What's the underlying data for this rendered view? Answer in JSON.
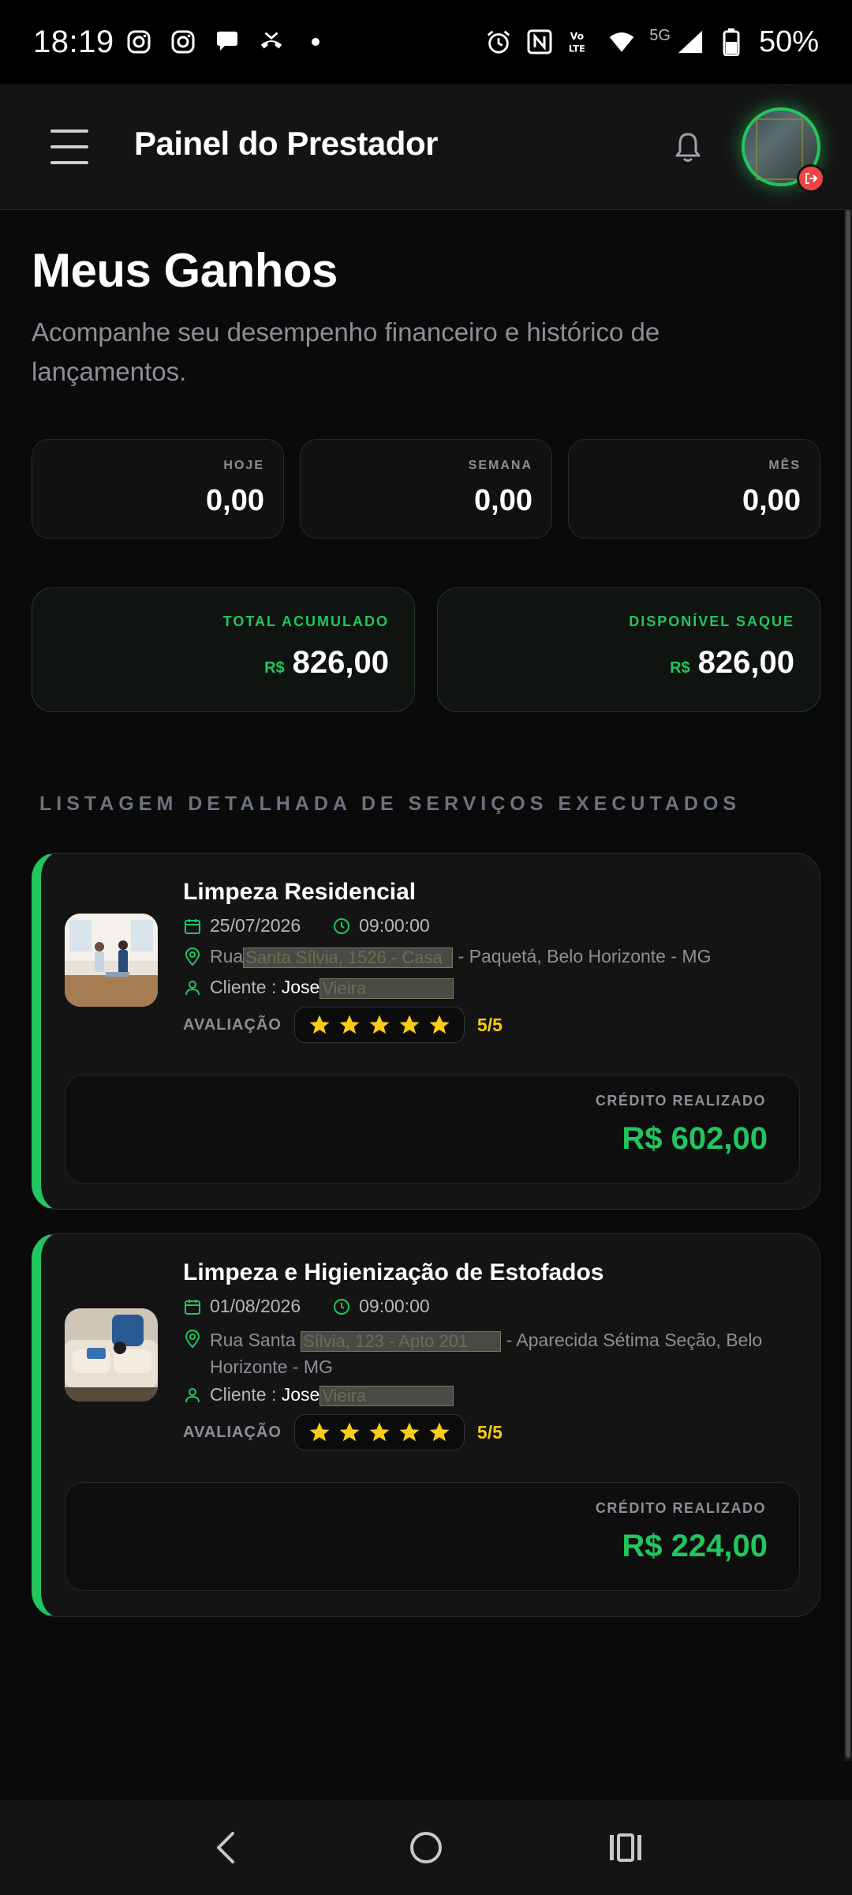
{
  "status_bar": {
    "time": "18:19",
    "network": "5G",
    "battery": "50%"
  },
  "header": {
    "title": "Painel do Prestador"
  },
  "page": {
    "title": "Meus Ganhos",
    "subtitle": "Acompanhe seu desempenho financeiro e histórico de lançamentos."
  },
  "stats": {
    "hoje": {
      "label": "HOJE",
      "value": "0,00"
    },
    "semana": {
      "label": "SEMANA",
      "value": "0,00"
    },
    "mes": {
      "label": "MÊS",
      "value": "0,00"
    },
    "total": {
      "label": "TOTAL ACUMULADO",
      "currency": "R$",
      "value": "826,00"
    },
    "disponivel": {
      "label": "DISPONÍVEL SAQUE",
      "currency": "R$",
      "value": "826,00"
    }
  },
  "section_heading": "LISTAGEM DETALHADA DE SERVIÇOS EXECUTADOS",
  "services": [
    {
      "title": "Limpeza Residencial",
      "date": "25/07/2026",
      "time": "09:00:00",
      "address_prefix": "Rua",
      "address_redacted": "Santa Sílvia, 1526 - Casa",
      "address_suffix": "- Paquetá, Belo Horizonte - MG",
      "client_label": "Cliente :",
      "client_name": "Jose",
      "client_redacted": "Vieira",
      "rating_label": "AVALIAÇÃO",
      "rating_score": "5/5",
      "rating_stars": 5,
      "credit_label": "CRÉDITO REALIZADO",
      "credit_value": "R$ 602,00"
    },
    {
      "title": "Limpeza e Higienização de Estofados",
      "date": "01/08/2026",
      "time": "09:00:00",
      "address_prefix": "Rua Santa",
      "address_redacted": "Sílvia, 123 - Apto 201",
      "address_suffix": "- Aparecida Sétima Seção, Belo Horizonte - MG",
      "client_label": "Cliente :",
      "client_name": "Jose",
      "client_redacted": "Vieira",
      "rating_label": "AVALIAÇÃO",
      "rating_score": "5/5",
      "rating_stars": 5,
      "credit_label": "CRÉDITO REALIZADO",
      "credit_value": "R$ 224,00"
    }
  ],
  "colors": {
    "accent": "#22c55e",
    "star": "#facc15",
    "background": "#0a0a0a",
    "danger": "#ef4444"
  }
}
